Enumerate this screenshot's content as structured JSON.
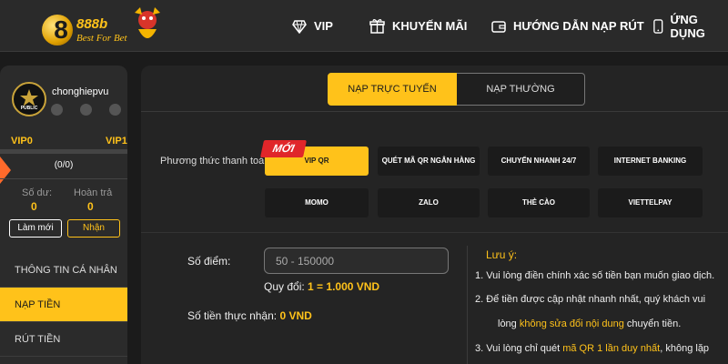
{
  "header": {
    "logo_mark": "8",
    "logo_name": "888b",
    "logo_tagline": "Best For Bet",
    "nav": [
      {
        "label": "VIP",
        "icon": "diamond-icon"
      },
      {
        "label": "KHUYẾN MÃI",
        "icon": "gift-icon"
      },
      {
        "label": "HƯỚNG DẪN NẠP RÚT",
        "icon": "wallet-icon"
      },
      {
        "label": "ỨNG DỤNG",
        "icon": "phone-icon"
      }
    ]
  },
  "profile": {
    "avatar_text": "PUBLIC",
    "username": "chonghiepvu",
    "vip_current": "VIP0",
    "vip_next": "VIP1",
    "vip_progress_fraction": 0,
    "progress_text": "(0/0)",
    "balance_label": "Số dư:",
    "balance_value": "0",
    "refund_label": "Hoàn trả",
    "refund_value": "0",
    "refresh_button": "Làm mới",
    "receive_button": "Nhận"
  },
  "menu": [
    {
      "label": "THÔNG TIN CÁ NHÂN",
      "active": false
    },
    {
      "label": "NẠP TIỀN",
      "active": true
    },
    {
      "label": "RÚT TIỀN",
      "active": false
    }
  ],
  "tabs": {
    "online": "NẠP TRỰC TUYẾN",
    "normal": "NẠP THƯỜNG"
  },
  "payment": {
    "label": "Phương thức thanh toán",
    "new_badge": "MỚI",
    "methods": [
      {
        "label": "VIP QR",
        "selected": true
      },
      {
        "label": "QUÉT MÃ QR NGÂN HÀNG",
        "selected": false
      },
      {
        "label": "CHUYỂN NHANH 24/7",
        "selected": false
      },
      {
        "label": "INTERNET BANKING",
        "selected": false
      },
      {
        "label": "MOMO",
        "selected": false
      },
      {
        "label": "ZALO",
        "selected": false
      },
      {
        "label": "THẺ CÀO",
        "selected": false
      },
      {
        "label": "VIETTELPAY",
        "selected": false
      }
    ]
  },
  "deposit": {
    "points_label": "Số điểm:",
    "points_placeholder": "50 - 150000",
    "points_value": "",
    "conversion_label": "Quy đổi:",
    "conversion_value": "1 = 1.000 VND",
    "received_label": "Số tiền thực nhận:",
    "received_value": "0 VND"
  },
  "notes": {
    "title": "Lưu ý:",
    "item1": "1. Vui lòng điền chính xác số tiền bạn muốn giao dịch.",
    "item2_line1": "2. Để tiền được cập nhật nhanh nhất, quý khách vui",
    "item2_line2_pre": "lòng ",
    "item2_line2_highlight": "không sửa đổi nội dung",
    "item2_line2_post": " chuyển tiền.",
    "item3_pre": "3. Vui lòng chỉ quét ",
    "item3_highlight": "mã QR 1 lần duy nhất",
    "item3_post": ", không lặp"
  },
  "colors": {
    "accent": "#ffc21a",
    "background": "#1b1b1b",
    "panel": "#242424",
    "badge_red": "#e0262a"
  }
}
